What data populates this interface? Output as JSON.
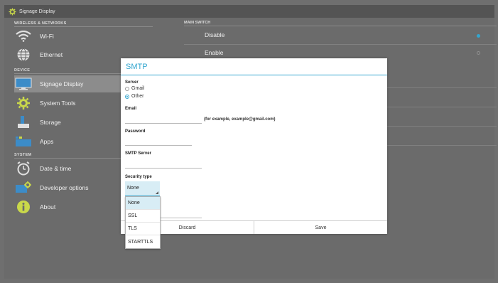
{
  "window": {
    "title": "Signage Display"
  },
  "sidebar": {
    "sections": [
      {
        "header": "WIRELESS & NETWORKS",
        "items": [
          {
            "label": "Wi-Fi",
            "icon": "wifi-icon"
          },
          {
            "label": "Ethernet",
            "icon": "ethernet-icon"
          }
        ]
      },
      {
        "header": "DEVICE",
        "items": [
          {
            "label": "Signage Display",
            "icon": "display-icon",
            "active": true
          },
          {
            "label": "System Tools",
            "icon": "gear-icon"
          },
          {
            "label": "Storage",
            "icon": "storage-icon"
          },
          {
            "label": "Apps",
            "icon": "apps-icon"
          }
        ]
      },
      {
        "header": "SYSTEM",
        "items": [
          {
            "label": "Date & time",
            "icon": "clock-icon"
          },
          {
            "label": "Developer options",
            "icon": "developer-icon"
          },
          {
            "label": "About",
            "icon": "info-icon"
          }
        ]
      }
    ]
  },
  "main": {
    "header": "MAIN SWITCH",
    "options": [
      {
        "label": "Disable",
        "selected": true
      },
      {
        "label": "Enable",
        "selected": false
      }
    ]
  },
  "dialog": {
    "title": "SMTP",
    "server_label": "Server",
    "server_options": [
      {
        "label": "Gmail",
        "selected": false
      },
      {
        "label": "Other",
        "selected": true
      }
    ],
    "email_label": "Email",
    "email_value": "",
    "email_hint": "(for example, example@gmail.com)",
    "password_label": "Password",
    "password_value": "",
    "smtp_server_label": "SMTP Server",
    "smtp_server_value": "",
    "security_label": "Security type",
    "security_value": "None",
    "security_options": [
      "None",
      "SSL",
      "TLS",
      "STARTTLS"
    ],
    "discard_label": "Discard",
    "save_label": "Save"
  },
  "colors": {
    "accent": "#33a6cf",
    "background": "#6b6b6b",
    "titlebar": "#545454",
    "active_item": "#8c8c8c"
  }
}
